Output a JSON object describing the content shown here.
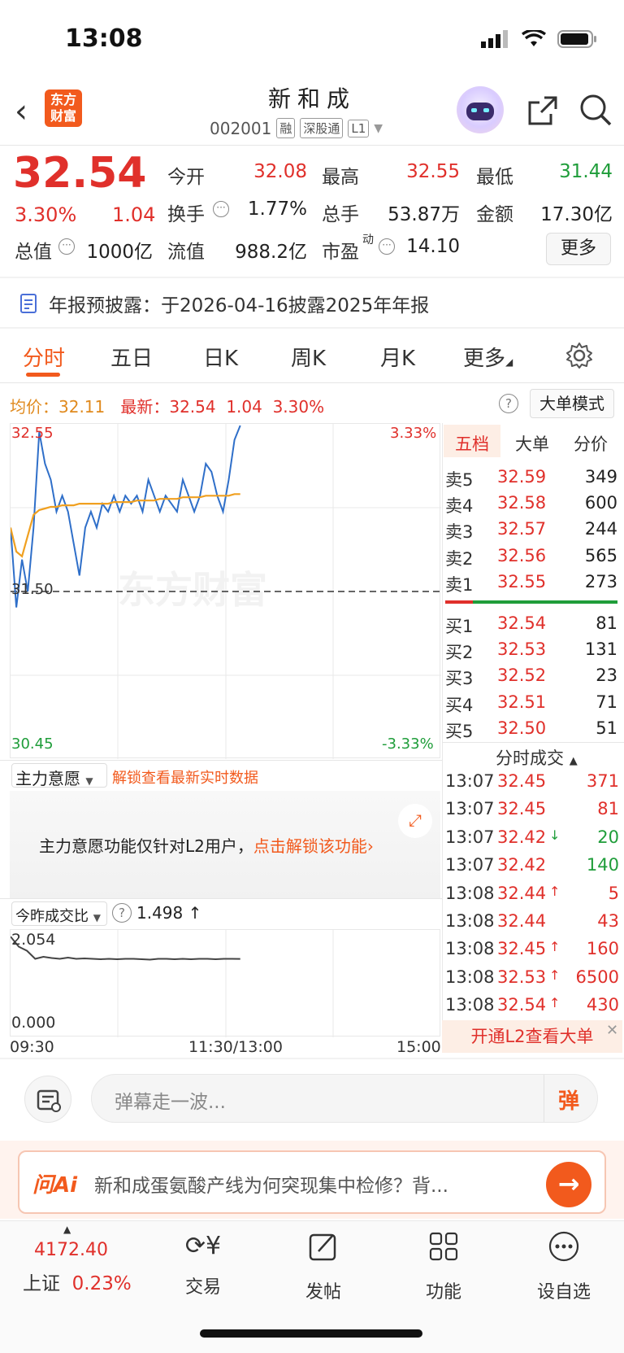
{
  "status_bar": {
    "time": "13:08"
  },
  "header": {
    "logo_text_1": "东方",
    "logo_text_2": "财富",
    "stock_name": "新和成",
    "stock_code": "002001",
    "tags": [
      "融",
      "深股通",
      "L1"
    ]
  },
  "quote": {
    "price": "32.54",
    "change_pct": "3.30%",
    "change": "1.04",
    "stats": [
      {
        "label": "今开",
        "value": "32.08",
        "color": "red"
      },
      {
        "label": "最高",
        "value": "32.55",
        "color": "red"
      },
      {
        "label": "最低",
        "value": "31.44",
        "color": "green"
      },
      {
        "label": "换手",
        "value": "1.77%",
        "color": "black"
      },
      {
        "label": "总手",
        "value": "53.87万",
        "color": "black"
      },
      {
        "label": "金额",
        "value": "17.30亿",
        "color": "black"
      },
      {
        "label": "总值",
        "value": "1000亿",
        "color": "black"
      },
      {
        "label": "流值",
        "value": "988.2亿",
        "color": "black"
      },
      {
        "label": "市盈",
        "value": "14.10",
        "color": "black"
      }
    ],
    "pe_superscript": "动",
    "more_label": "更多"
  },
  "notice": {
    "text": "年报预披露：于2026-04-16披露2025年年报"
  },
  "tabs": [
    "分时",
    "五日",
    "日K",
    "周K",
    "月K",
    "更多"
  ],
  "active_tab": "分时",
  "info_line": {
    "avg_label": "均价：",
    "avg_value": "32.11",
    "latest_label": "最新：",
    "latest_value": "32.54",
    "latest_change": "1.04",
    "latest_pct": "3.30%",
    "big_order_mode": "大单模式"
  },
  "chart_data": {
    "type": "line",
    "y_left_ticks": [
      "32.55",
      "31.50",
      "30.45"
    ],
    "y_right_ticks": [
      "3.33%",
      "-3.33%"
    ],
    "watermark": "东方财富",
    "x_ticks": [
      "09:30",
      "11:30/13:00",
      "15:00"
    ],
    "series": [
      {
        "values": [
          31.9,
          31.4,
          31.7,
          31.5,
          31.9,
          32.5,
          32.3,
          32.2,
          32.0,
          32.1,
          32.0,
          31.8,
          31.6,
          31.9,
          32.0,
          31.9,
          32.05,
          32.0,
          32.1,
          32.0,
          32.1,
          32.05,
          32.1,
          32.0,
          32.2,
          32.1,
          32.0,
          32.1,
          32.05,
          32.0,
          32.2,
          32.1,
          32.0,
          32.1,
          32.3,
          32.25,
          32.1,
          32.0,
          32.2,
          32.45,
          32.54
        ]
      },
      {
        "values": [
          31.9,
          31.75,
          31.72,
          31.85,
          31.98,
          32.01,
          32.02,
          32.03,
          32.03,
          32.04,
          32.04,
          32.04,
          32.05,
          32.05,
          32.05,
          32.05,
          32.05,
          32.05,
          32.06,
          32.06,
          32.06,
          32.06,
          32.07,
          32.07,
          32.07,
          32.07,
          32.08,
          32.08,
          32.08,
          32.08,
          32.09,
          32.09,
          32.09,
          32.09,
          32.1,
          32.1,
          32.1,
          32.1,
          32.1,
          32.11,
          32.11
        ]
      }
    ],
    "ylim": [
      30.45,
      32.55
    ],
    "prev_close": 31.5
  },
  "order_book": {
    "tabs": [
      "五档",
      "大单",
      "分价"
    ],
    "asks": [
      {
        "label": "卖5",
        "price": "32.59",
        "vol": "349"
      },
      {
        "label": "卖4",
        "price": "32.58",
        "vol": "600"
      },
      {
        "label": "卖3",
        "price": "32.57",
        "vol": "244"
      },
      {
        "label": "卖2",
        "price": "32.56",
        "vol": "565"
      },
      {
        "label": "卖1",
        "price": "32.55",
        "vol": "273"
      }
    ],
    "bids": [
      {
        "label": "买1",
        "price": "32.54",
        "vol": "81"
      },
      {
        "label": "买2",
        "price": "32.53",
        "vol": "131"
      },
      {
        "label": "买3",
        "price": "32.52",
        "vol": "23"
      },
      {
        "label": "买4",
        "price": "32.51",
        "vol": "71"
      },
      {
        "label": "买5",
        "price": "32.50",
        "vol": "51"
      }
    ],
    "trades_title": "分时成交",
    "trades": [
      {
        "time": "13:07",
        "price": "32.45",
        "arrow": "",
        "vol": "371",
        "vol_color": "red"
      },
      {
        "time": "13:07",
        "price": "32.45",
        "arrow": "",
        "vol": "81",
        "vol_color": "red"
      },
      {
        "time": "13:07",
        "price": "32.42",
        "arrow": "↓",
        "vol": "20",
        "vol_color": "green"
      },
      {
        "time": "13:07",
        "price": "32.42",
        "arrow": "",
        "vol": "140",
        "vol_color": "green"
      },
      {
        "time": "13:08",
        "price": "32.44",
        "arrow": "↑",
        "vol": "5",
        "vol_color": "red"
      },
      {
        "time": "13:08",
        "price": "32.44",
        "arrow": "",
        "vol": "43",
        "vol_color": "red"
      },
      {
        "time": "13:08",
        "price": "32.45",
        "arrow": "↑",
        "vol": "160",
        "vol_color": "red"
      },
      {
        "time": "13:08",
        "price": "32.53",
        "arrow": "↑",
        "vol": "6500",
        "vol_color": "red"
      },
      {
        "time": "13:08",
        "price": "32.54",
        "arrow": "↑",
        "vol": "430",
        "vol_color": "red"
      }
    ],
    "l2_promo": "开通L2查看大单"
  },
  "main_force": {
    "dropdown": "主力意愿",
    "unlock_link": "解锁查看最新实时数据",
    "message": "主力意愿功能仅针对L2用户，",
    "unlock_action": "点击解锁该功能"
  },
  "volume_ratio": {
    "dropdown": "今昨成交比",
    "value": "1.498",
    "arrow": "↑",
    "y_top": "2.054",
    "y_bottom": "0.000",
    "values": [
      2.05,
      1.8,
      1.7,
      1.5,
      1.55,
      1.52,
      1.5,
      1.53,
      1.5,
      1.51,
      1.5,
      1.49,
      1.5,
      1.49,
      1.5,
      1.5,
      1.49,
      1.48,
      1.5,
      1.5,
      1.49,
      1.5,
      1.49,
      1.5,
      1.5,
      1.49,
      1.5,
      1.5,
      1.498
    ]
  },
  "danmaku": {
    "placeholder": "弹幕走一波...",
    "button": "弹"
  },
  "ai": {
    "logo": "问Ai",
    "question": "新和成蛋氨酸产线为何突现集中检修？背..."
  },
  "bottom_nav": {
    "index_value": "4172.40",
    "index_name": "上证",
    "index_pct": "0.23%",
    "items": [
      "交易",
      "发帖",
      "功能",
      "设自选"
    ]
  }
}
